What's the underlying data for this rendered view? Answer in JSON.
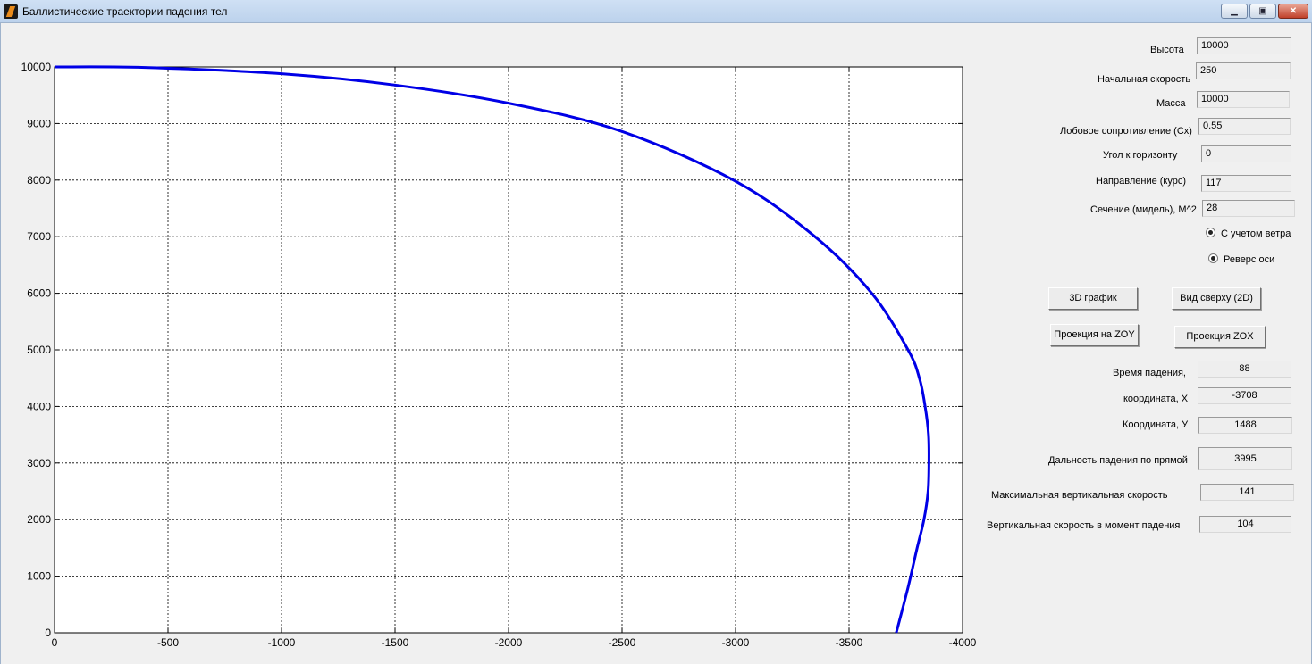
{
  "window": {
    "title": "Баллистические траектории падения тел",
    "minimize_glyph": "▁",
    "maximize_glyph": "▣",
    "close_glyph": "✕",
    "icon": "matlab-icon"
  },
  "inputs": {
    "height": {
      "label": "Высота",
      "value": "10000"
    },
    "initial_speed": {
      "label": "Начальная скорость",
      "value": "250"
    },
    "mass": {
      "label": "Масса",
      "value": "10000"
    },
    "drag": {
      "label": "Лобовое сопротивление (Cx)",
      "value": "0.55"
    },
    "angle": {
      "label": "Угол к горизонту",
      "value": "0"
    },
    "heading": {
      "label": "Направление  (курс)",
      "value": "117"
    },
    "section": {
      "label": "Сечение (мидель), М^2",
      "value": "28"
    }
  },
  "options": {
    "wind": {
      "label": "С учетом ветра",
      "checked": true
    },
    "reverse_axis": {
      "label": "Реверс оси",
      "checked": true
    }
  },
  "buttons": {
    "plot3d": "3D график",
    "top_view": "Вид сверху (2D)",
    "zoy": "Проекция на ZOY",
    "zox": "Проекция ZOX"
  },
  "results": {
    "fall_time": {
      "label": "Время падения,",
      "value": "88"
    },
    "coord_x": {
      "label": "координата, X",
      "value": "-3708"
    },
    "coord_y": {
      "label": "Координата, У",
      "value": "1488"
    },
    "range": {
      "label": "Дальность падения по прямой",
      "value": "3995"
    },
    "max_vspeed": {
      "label": "Максимальная вертикальная скорость",
      "value": "141"
    },
    "impact_vspeed": {
      "label": "Вертикальная  скорость в момент падения",
      "value": "104"
    }
  },
  "chart_data": {
    "type": "line",
    "title": "",
    "xlabel": "",
    "ylabel": "",
    "xlim": [
      0,
      -4000
    ],
    "ylim": [
      0,
      10000
    ],
    "x_reversed": true,
    "grid": true,
    "x_ticks": [
      0,
      -500,
      -1000,
      -1500,
      -2000,
      -2500,
      -3000,
      -3500,
      -4000
    ],
    "y_ticks": [
      0,
      1000,
      2000,
      3000,
      4000,
      5000,
      6000,
      7000,
      8000,
      9000,
      10000
    ],
    "line_color": "#0000e6",
    "series": [
      {
        "x": [
          0,
          -400,
          -1000,
          -1500,
          -2000,
          -2500,
          -3000,
          -3350,
          -3600,
          -3760,
          -3810,
          -3835,
          -3850,
          -3852,
          -3848,
          -3830,
          -3800,
          -3760,
          -3708
        ],
        "y": [
          10000,
          9990,
          9880,
          9680,
          9360,
          8860,
          7980,
          7000,
          6000,
          5000,
          4500,
          4000,
          3500,
          3000,
          2500,
          2000,
          1500,
          800,
          0
        ]
      }
    ]
  }
}
